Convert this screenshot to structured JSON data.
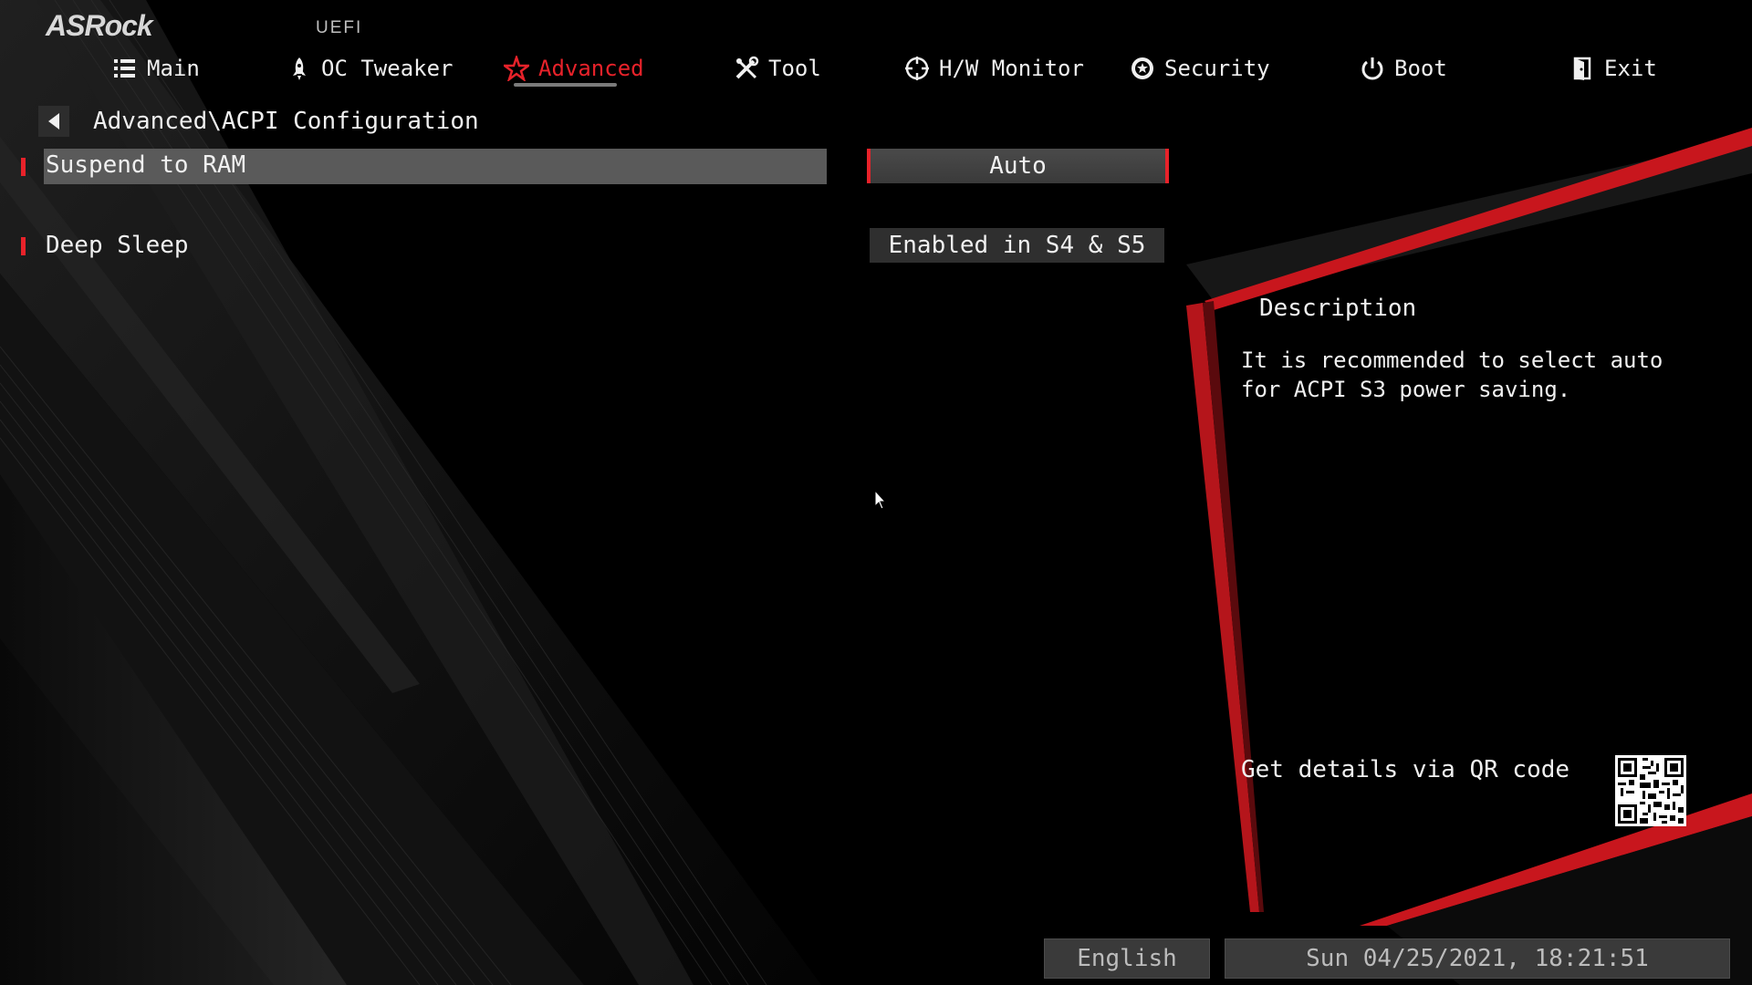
{
  "header": {
    "brand": "ASRock",
    "uefi_label": "UEFI",
    "tabs": [
      {
        "label": "Main",
        "icon": "list-icon"
      },
      {
        "label": "OC Tweaker",
        "icon": "rocket-icon"
      },
      {
        "label": "Advanced",
        "icon": "star-icon",
        "active": true
      },
      {
        "label": "Tool",
        "icon": "tools-icon"
      },
      {
        "label": "H/W Monitor",
        "icon": "crosshair-icon"
      },
      {
        "label": "Security",
        "icon": "shield-icon"
      },
      {
        "label": "Boot",
        "icon": "power-icon"
      },
      {
        "label": "Exit",
        "icon": "exit-door-icon"
      }
    ]
  },
  "breadcrumb": {
    "path": "Advanced\\ACPI Configuration"
  },
  "settings": [
    {
      "label": "Suspend to RAM",
      "value": "Auto",
      "selected": true
    },
    {
      "label": "Deep Sleep",
      "value": "Enabled in S4 & S5",
      "selected": false
    }
  ],
  "description": {
    "title": "Description",
    "text": "It is recommended to select auto for ACPI S3 power saving.",
    "qr_label": "Get details via QR code"
  },
  "footer": {
    "language": "English",
    "datetime": "Sun 04/25/2021, 18:21:51"
  },
  "colors": {
    "accent": "#e8222a",
    "background": "#000000",
    "text": "#f0f0f0"
  }
}
